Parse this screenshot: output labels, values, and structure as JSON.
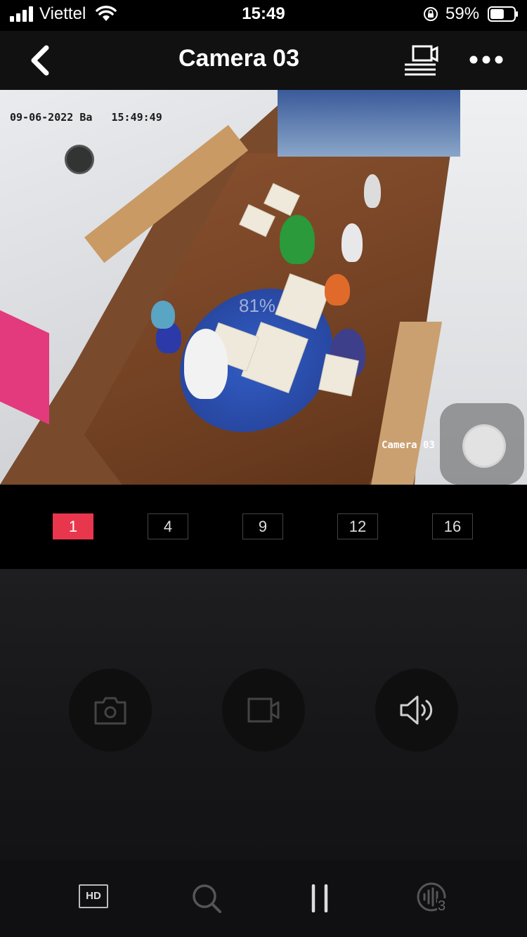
{
  "status_bar": {
    "carrier": "Viettel",
    "time": "15:49",
    "battery_percent": "59%",
    "battery_level": 0.59
  },
  "nav": {
    "title": "Camera 03"
  },
  "camera": {
    "timestamp": "09-06-2022 Ba   15:49:49",
    "overlay_label": "Camera 03",
    "loading_text": "81%"
  },
  "layout_options": {
    "items": [
      "1",
      "4",
      "9",
      "12",
      "16"
    ],
    "selected": "1"
  },
  "controls": {
    "snapshot_icon": "camera-icon",
    "record_icon": "video-record-icon",
    "audio_icon": "speaker-icon"
  },
  "toolbar": {
    "hd_label": "HD",
    "zoom_icon": "search-icon",
    "pause_icon": "pause-icon",
    "stream_icon": "stream-3-icon",
    "stream_badge": "3"
  },
  "colors": {
    "accent": "#e8374d",
    "background": "#000000",
    "controls_bg": "#1a1a1c"
  }
}
